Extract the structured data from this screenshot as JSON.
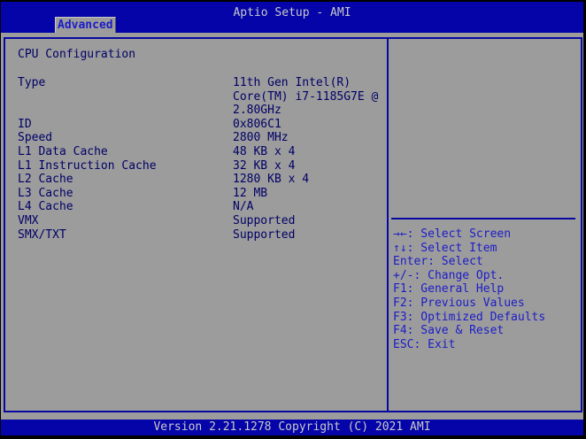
{
  "header": {
    "title": "Aptio Setup - AMI",
    "tab": "Advanced"
  },
  "main": {
    "heading": "CPU Configuration",
    "rows": [
      {
        "label": "Type",
        "value": "11th Gen Intel(R)\nCore(TM) i7-1185G7E @\n2.80GHz"
      },
      {
        "label": "ID",
        "value": "0x806C1"
      },
      {
        "label": "Speed",
        "value": "2800 MHz"
      },
      {
        "label": "L1 Data Cache",
        "value": "48 KB x 4"
      },
      {
        "label": "L1 Instruction Cache",
        "value": "32 KB x 4"
      },
      {
        "label": "L2 Cache",
        "value": "1280 KB x 4"
      },
      {
        "label": "L3 Cache",
        "value": "12 MB"
      },
      {
        "label": "L4 Cache",
        "value": "N/A"
      },
      {
        "label": "VMX",
        "value": "Supported"
      },
      {
        "label": "SMX/TXT",
        "value": "Supported"
      }
    ]
  },
  "help": {
    "lines": [
      "→←: Select Screen",
      "↑↓: Select Item",
      "Enter: Select",
      "+/-: Change Opt.",
      "F1: General Help",
      "F2: Previous Values",
      "F3: Optimized Defaults",
      "F4: Save & Reset",
      "ESC: Exit"
    ]
  },
  "footer": {
    "version": "Version 2.21.1278 Copyright (C) 2021 AMI"
  },
  "colors": {
    "bar_blue": "#0404A8",
    "body_gray": "#9C9C9C",
    "border_blue": "#0808A0",
    "text_navy": "#000066",
    "help_blue": "#1C1CC8",
    "bar_text": "#C9C9C9"
  }
}
